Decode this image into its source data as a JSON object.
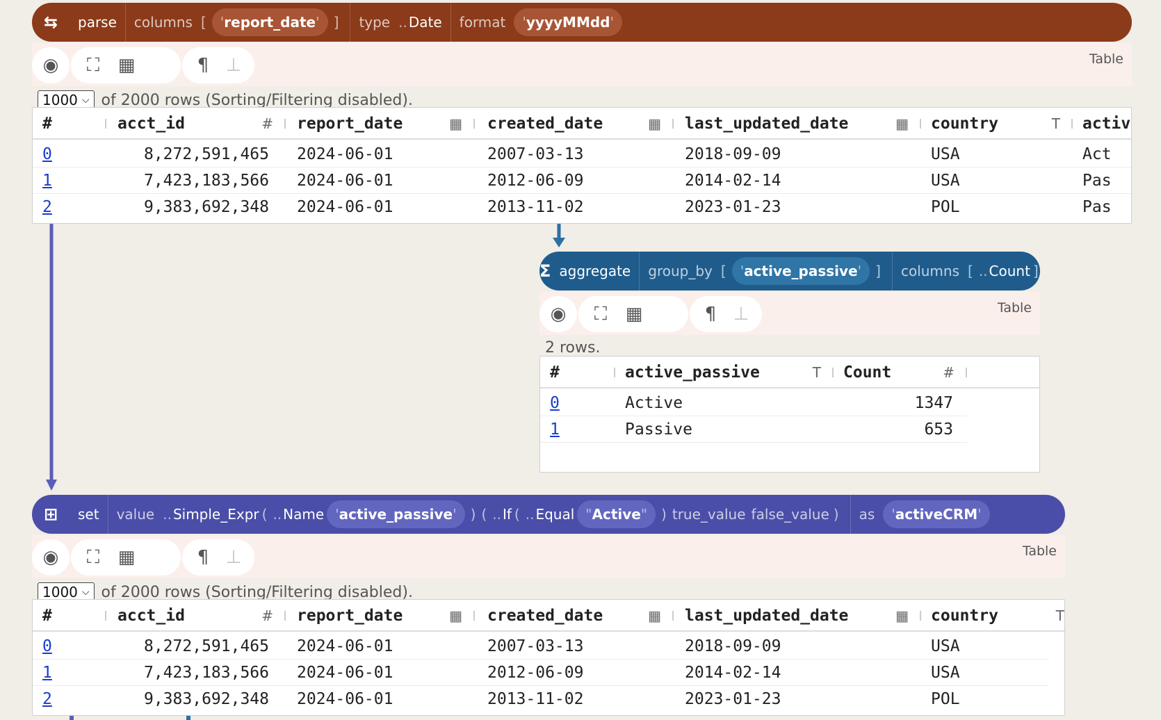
{
  "parse_node": {
    "icon": "swap-arrows-icon",
    "name": "parse",
    "columns_label": "columns",
    "column_value": "report_date",
    "type_label": "type",
    "type_dots": "..",
    "type_value": "Date",
    "format_label": "format",
    "format_value": "yyyyMMdd",
    "view_label": "Table",
    "rows_select": "1000",
    "rows_info": "of 2000 rows (Sorting/Filtering disabled).",
    "table": {
      "headers": [
        "#",
        "acct_id",
        "report_date",
        "created_date",
        "last_updated_date",
        "country",
        "activ"
      ],
      "header_icons": [
        "",
        "#",
        "calendar-icon",
        "calendar-icon",
        "calendar-icon",
        "T",
        ""
      ],
      "rows": [
        [
          "0",
          "8,272,591,465",
          "2024-06-01",
          "2007-03-13",
          "2018-09-09",
          "USA",
          "Act"
        ],
        [
          "1",
          "7,423,183,566",
          "2024-06-01",
          "2012-06-09",
          "2014-02-14",
          "USA",
          "Pas"
        ],
        [
          "2",
          "9,383,692,348",
          "2024-06-01",
          "2013-11-02",
          "2023-01-23",
          "POL",
          "Pas"
        ]
      ]
    }
  },
  "aggregate_node": {
    "icon": "sigma-icon",
    "name": "aggregate",
    "group_by_label": "group_by",
    "group_by_value": "active_passive",
    "columns_label": "columns",
    "columns_dots": "..",
    "columns_value": "Count",
    "view_label": "Table",
    "rows_info": "2 rows.",
    "table": {
      "headers": [
        "#",
        "active_passive",
        "Count"
      ],
      "header_icons": [
        "",
        "T",
        "#"
      ],
      "rows": [
        [
          "0",
          "Active",
          "1347"
        ],
        [
          "1",
          "Passive",
          "653"
        ]
      ]
    }
  },
  "set_node": {
    "icon": "add-column-icon",
    "name": "set",
    "value_label": "value",
    "expr_dots": "..",
    "expr": "Simple_Expr",
    "name_dots": "..",
    "name_label": "Name",
    "name_value": "active_passive",
    "if_dots": "..",
    "if_label": "If",
    "equal_dots": "..",
    "equal_label": "Equal",
    "equal_value": "Active",
    "true_label": "true_value",
    "false_label": "false_value",
    "as_label": "as",
    "as_value": "activeCRM",
    "view_label": "Table",
    "rows_select": "1000",
    "rows_info": "of 2000 rows (Sorting/Filtering disabled).",
    "table": {
      "headers": [
        "#",
        "acct_id",
        "report_date",
        "created_date",
        "last_updated_date",
        "country"
      ],
      "header_icons": [
        "",
        "#",
        "calendar-icon",
        "calendar-icon",
        "calendar-icon",
        "T"
      ],
      "rows": [
        [
          "0",
          "8,272,591,465",
          "2024-06-01",
          "2007-03-13",
          "2018-09-09",
          "USA"
        ],
        [
          "1",
          "7,423,183,566",
          "2024-06-01",
          "2012-06-09",
          "2014-02-14",
          "USA"
        ],
        [
          "2",
          "9,383,692,348",
          "2024-06-01",
          "2013-11-02",
          "2023-01-23",
          "POL"
        ]
      ]
    }
  },
  "toolbar_icons": [
    "eye-icon",
    "expand-icon",
    "grid-icon",
    "pilcrow-icon",
    "add-row-icon"
  ],
  "colors": {
    "parse": "#8b3a1a",
    "aggregate": "#1f5c8c",
    "set": "#4a4ea8",
    "link": "#1a3ccf"
  }
}
